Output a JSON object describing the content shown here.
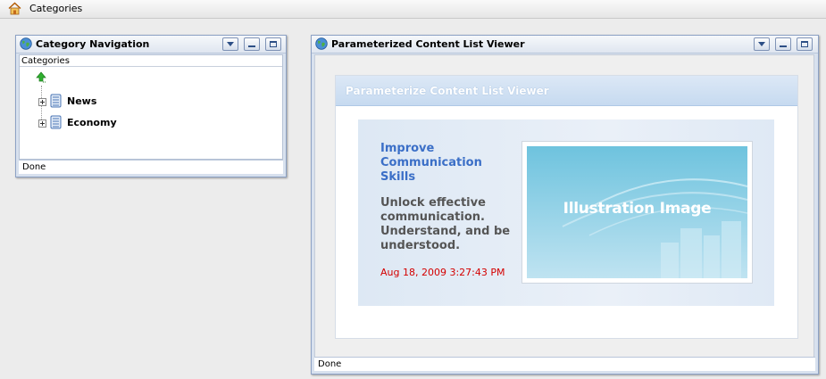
{
  "breadcrumb": {
    "label": "Categories"
  },
  "nav_portlet": {
    "title": "Category Navigation",
    "header": "Categories",
    "nodes": [
      {
        "label": "News"
      },
      {
        "label": "Economy"
      }
    ],
    "status": "Done"
  },
  "viewer_portlet": {
    "title": "Parameterized Content List Viewer",
    "panel_title": "Parameterize Content List Viewer",
    "item": {
      "title": "Improve Communication Skills",
      "description": "Unlock effective communication. Understand, and be understood.",
      "date": "Aug 18, 2009 3:27:43 PM",
      "image_caption": "Illustration Image"
    },
    "status": "Done"
  },
  "colors": {
    "item_title": "#3b6fc7",
    "date": "#d40000",
    "panel_header": "#c6daf0"
  },
  "icons": [
    "home-icon",
    "globe-icon",
    "dropdown-icon",
    "minimize-icon",
    "maximize-icon",
    "up-arrow-icon",
    "expand-icon",
    "folder-icon",
    "scroll-left-icon",
    "scroll-right-icon"
  ]
}
